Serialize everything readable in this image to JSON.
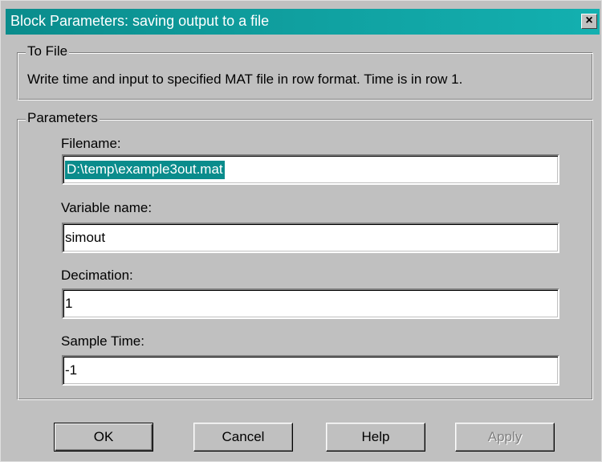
{
  "window": {
    "title": "Block Parameters: saving output to a file",
    "close_glyph": "×"
  },
  "to_file": {
    "group_label": "To File",
    "description": "Write time and input to specified MAT file in row format.  Time is in row 1."
  },
  "parameters": {
    "group_label": "Parameters",
    "filename": {
      "label": "Filename:",
      "value": "D:\\temp\\example3out.mat"
    },
    "variable_name": {
      "label": "Variable name:",
      "value": "simout"
    },
    "decimation": {
      "label": "Decimation:",
      "value": "1"
    },
    "sample_time": {
      "label": "Sample Time:",
      "value": "-1"
    }
  },
  "buttons": {
    "ok": "OK",
    "cancel": "Cancel",
    "help": "Help",
    "apply": "Apply"
  },
  "colors": {
    "title_bar": "#0a8c8c",
    "selection": "#0a8c8c",
    "face": "#c0c0c0"
  }
}
